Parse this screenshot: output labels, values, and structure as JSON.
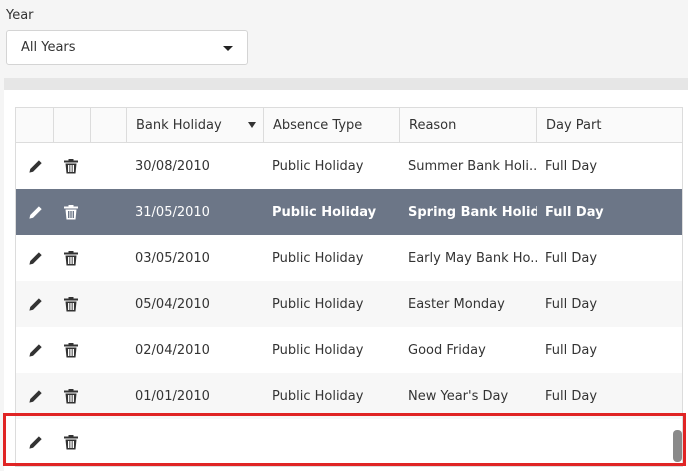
{
  "filter": {
    "label": "Year",
    "selected": "All Years"
  },
  "grid": {
    "columns": [
      "",
      "",
      "",
      "Bank Holiday",
      "Absence Type",
      "Reason",
      "Day Part"
    ],
    "sort_column": "Bank Holiday",
    "sort_direction": "descending",
    "rows": [
      {
        "date": "30/08/2010",
        "type": "Public Holiday",
        "reason": "Summer Bank Holi...",
        "daypart": "Full Day"
      },
      {
        "date": "31/05/2010",
        "type": "Public Holiday",
        "reason": "Spring Bank Holiday",
        "daypart": "Full Day"
      },
      {
        "date": "03/05/2010",
        "type": "Public Holiday",
        "reason": "Early May Bank Ho...",
        "daypart": "Full Day"
      },
      {
        "date": "05/04/2010",
        "type": "Public Holiday",
        "reason": "Easter Monday",
        "daypart": "Full Day"
      },
      {
        "date": "02/04/2010",
        "type": "Public Holiday",
        "reason": "Good Friday",
        "daypart": "Full Day"
      },
      {
        "date": "01/01/2010",
        "type": "Public Holiday",
        "reason": "New Year's Day",
        "daypart": "Full Day"
      },
      {
        "date": "",
        "type": "",
        "reason": "",
        "daypart": ""
      }
    ],
    "selected_row_index": 1,
    "row_icons": [
      "pencil-icon",
      "trash-icon"
    ]
  },
  "colors": {
    "selected_row": "#6c7687",
    "highlight_border": "#e02424"
  }
}
